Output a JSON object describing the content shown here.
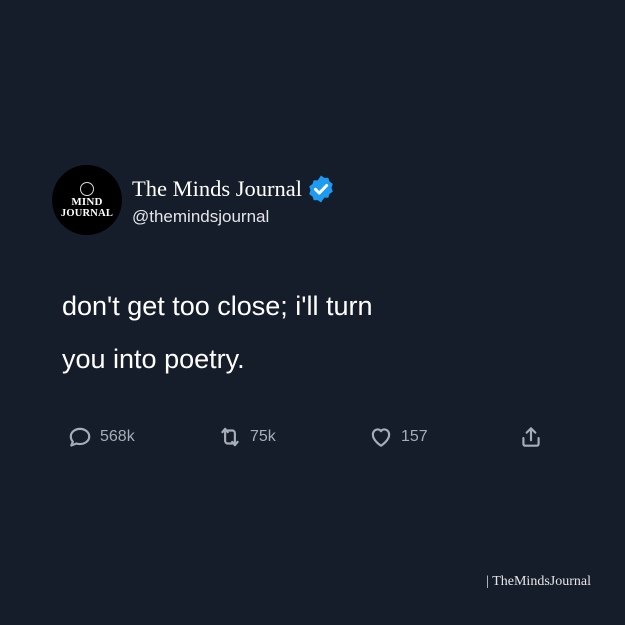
{
  "account": {
    "avatar_line_1": "MIND",
    "avatar_line_2": "JOURNAL",
    "display_name": "The Minds Journal",
    "handle": "@themindsjournal",
    "verified_icon": "verified-badge-icon"
  },
  "tweet": {
    "line_1": "don't get too close; i'll turn",
    "line_2": "you into poetry."
  },
  "actions": {
    "reply": {
      "icon": "reply-icon",
      "count": "568k"
    },
    "retweet": {
      "icon": "retweet-icon",
      "count": "75k"
    },
    "like": {
      "icon": "heart-icon",
      "count": "157"
    },
    "share": {
      "icon": "share-icon"
    }
  },
  "watermark": "| TheMindsJournal",
  "colors": {
    "background": "#161d2a",
    "text": "#ffffff",
    "muted": "#a6adb8",
    "verified": "#1d9bf0"
  }
}
